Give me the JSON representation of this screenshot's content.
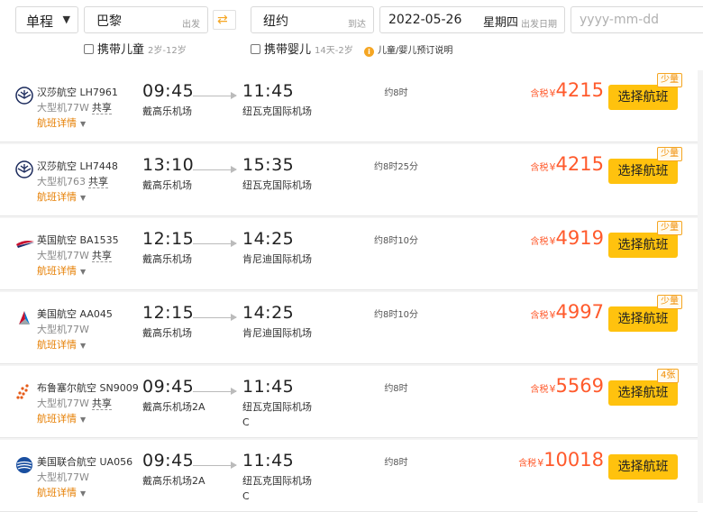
{
  "search": {
    "trip_type": "单程",
    "from_city": "巴黎",
    "from_hint": "出发",
    "to_city": "纽约",
    "to_hint": "到达",
    "date": "2022-05-26",
    "weekday": "星期四",
    "date_hint": "出发日期",
    "return_placeholder": "yyyy-mm-dd",
    "child_label": "携带儿童",
    "child_age": "2岁-12岁",
    "infant_label": "携带婴儿",
    "infant_age": "14天-2岁",
    "info_text": "儿童/婴儿预订说明",
    "info_icon": "i"
  },
  "colors": {
    "accent": "#ffc20e",
    "price": "#ff5a2c",
    "link": "#e67e00"
  },
  "flights": [
    {
      "airline": "汉莎航空 LH7961",
      "plane": "大型机77W",
      "share": "共享",
      "details": "航班详情",
      "dep_time": "09:45",
      "dep_airport": "戴高乐机场",
      "arr_time": "11:45",
      "arr_airport": "纽瓦克国际机场",
      "arr_terminal": "",
      "duration": "约8时",
      "tax_label": "含税",
      "currency": "¥",
      "price": "4215",
      "button": "选择航班",
      "badge": "少量",
      "logo": "lufthansa-logo"
    },
    {
      "airline": "汉莎航空 LH7448",
      "plane": "大型机763",
      "share": "共享",
      "details": "航班详情",
      "dep_time": "13:10",
      "dep_airport": "戴高乐机场",
      "arr_time": "15:35",
      "arr_airport": "纽瓦克国际机场",
      "arr_terminal": "",
      "duration": "约8时25分",
      "tax_label": "含税",
      "currency": "¥",
      "price": "4215",
      "button": "选择航班",
      "badge": "少量",
      "logo": "lufthansa-logo"
    },
    {
      "airline": "英国航空 BA1535",
      "plane": "大型机77W",
      "share": "共享",
      "details": "航班详情",
      "dep_time": "12:15",
      "dep_airport": "戴高乐机场",
      "arr_time": "14:25",
      "arr_airport": "肯尼迪国际机场",
      "arr_terminal": "",
      "duration": "约8时10分",
      "tax_label": "含税",
      "currency": "¥",
      "price": "4919",
      "button": "选择航班",
      "badge": "少量",
      "logo": "british-airways-logo"
    },
    {
      "airline": "美国航空 AA045",
      "plane": "大型机77W",
      "share": "",
      "details": "航班详情",
      "dep_time": "12:15",
      "dep_airport": "戴高乐机场",
      "arr_time": "14:25",
      "arr_airport": "肯尼迪国际机场",
      "arr_terminal": "",
      "duration": "约8时10分",
      "tax_label": "含税",
      "currency": "¥",
      "price": "4997",
      "button": "选择航班",
      "badge": "少量",
      "logo": "american-airlines-logo"
    },
    {
      "airline": "布鲁塞尔航空 SN9009",
      "plane": "大型机77W",
      "share": "共享",
      "details": "航班详情",
      "dep_time": "09:45",
      "dep_airport": "戴高乐机场2A",
      "arr_time": "11:45",
      "arr_airport": "纽瓦克国际机场",
      "arr_terminal": "C",
      "duration": "约8时",
      "tax_label": "含税",
      "currency": "¥",
      "price": "5569",
      "button": "选择航班",
      "badge": "4张",
      "logo": "brussels-airlines-logo"
    },
    {
      "airline": "美国联合航空 UA056",
      "plane": "大型机77W",
      "share": "",
      "details": "航班详情",
      "dep_time": "09:45",
      "dep_airport": "戴高乐机场2A",
      "arr_time": "11:45",
      "arr_airport": "纽瓦克国际机场",
      "arr_terminal": "C",
      "duration": "约8时",
      "tax_label": "含税",
      "currency": "¥",
      "price": "10018",
      "button": "选择航班",
      "badge": "",
      "logo": "united-airlines-logo"
    }
  ]
}
